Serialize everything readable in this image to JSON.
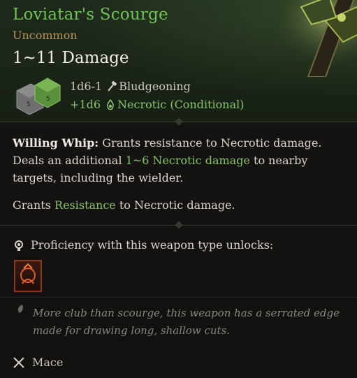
{
  "item": {
    "name": "Loviatar's Scourge",
    "rarity": "Uncommon",
    "damage_total": "1~11 Damage",
    "damage_lines": [
      {
        "dice": "1d6-1",
        "type": "Bludgeoning",
        "icon": "hammer-icon"
      },
      {
        "dice": "+1d6",
        "type": "Necrotic (Conditional)",
        "icon": "necrotic-icon"
      }
    ]
  },
  "description": {
    "ability_name": "Willing Whip:",
    "text_1": "Grants resistance to Necrotic damage. Deals an additional",
    "highlight": "1~6 Necrotic damage",
    "text_2": "to nearby targets, including the wielder.",
    "line2_prefix": "Grants",
    "line2_highlight": "Resistance",
    "line2_suffix": "to Necrotic damage."
  },
  "proficiency": {
    "label": "Proficiency with this weapon type unlocks:",
    "unlock_icon": "passive-ability-icon"
  },
  "flavor_text": "More club than scourge, this weapon has a serrated edge made for drawing long, shallow cuts.",
  "weapon_type": "Mace",
  "colors": {
    "title": "#6fc257",
    "rarity": "#b8935c",
    "necrotic": "#86c466",
    "text": "#ddd6c8"
  }
}
